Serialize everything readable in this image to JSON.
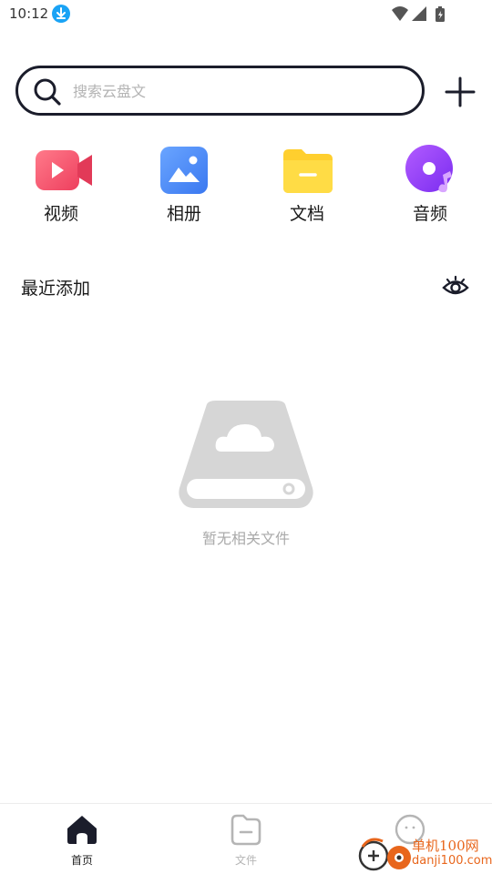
{
  "status_bar": {
    "time": "10:12",
    "icons": [
      "download-icon",
      "wifi-icon",
      "signal-icon",
      "battery-charging-icon"
    ]
  },
  "search": {
    "placeholder": "搜索云盘文",
    "value": "",
    "icon": "search-icon"
  },
  "add_button": {
    "icon": "plus-icon"
  },
  "categories": [
    {
      "label": "视频",
      "icon": "video-icon",
      "color": "#f0506e"
    },
    {
      "label": "相册",
      "icon": "photo-icon",
      "color": "#4a8cf7"
    },
    {
      "label": "文档",
      "icon": "folder-icon",
      "color": "#ffd234"
    },
    {
      "label": "音频",
      "icon": "music-icon",
      "color": "#8b3cf7"
    }
  ],
  "recent": {
    "title": "最近添加",
    "toggle_icon": "eye-icon"
  },
  "empty_state": {
    "icon": "cloud-drive-icon",
    "text": "暂无相关文件"
  },
  "bottom_nav": {
    "items": [
      {
        "label": "首页",
        "icon": "home-icon",
        "active": true
      },
      {
        "label": "文件",
        "icon": "file-icon",
        "active": false
      },
      {
        "label": "",
        "icon": "more-icon",
        "active": false
      }
    ]
  },
  "watermark": {
    "line1": "单机100网",
    "line2": "danji100.com"
  },
  "colors": {
    "accent_dark": "#1b1d2b",
    "muted_text": "#aaaaaa",
    "inactive_nav": "#b5b5b5",
    "watermark": "#e8661c"
  }
}
